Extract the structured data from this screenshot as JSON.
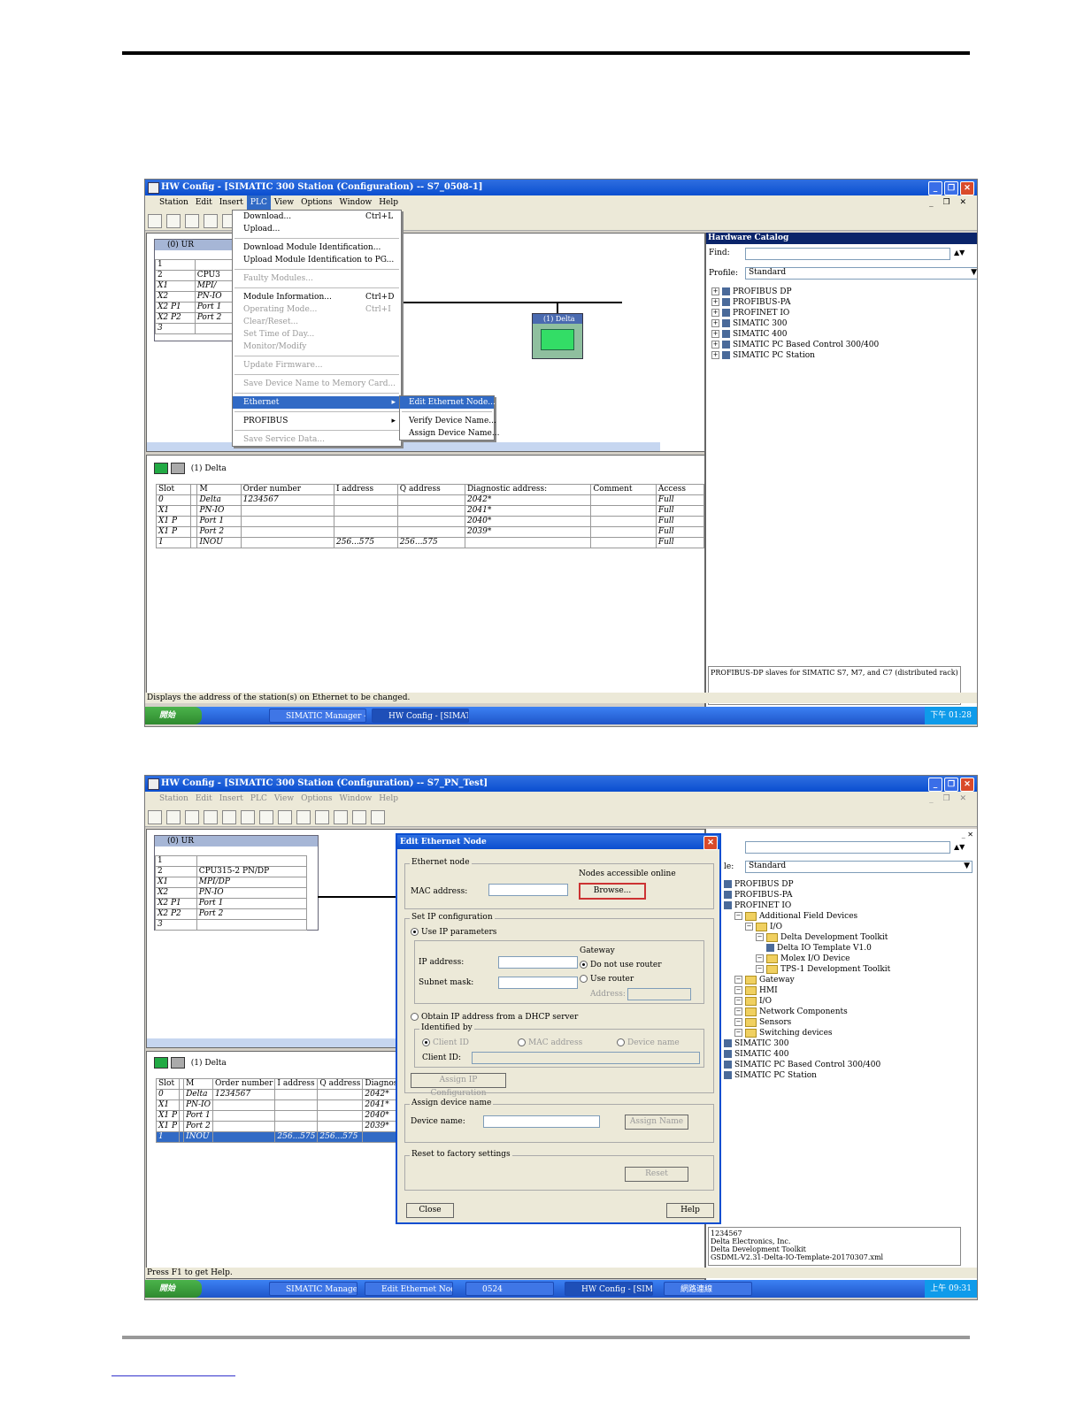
{
  "colors": {
    "titlebar": "#0a4ed0",
    "selection": "#316ac5",
    "start_button": "#2f8a2f"
  },
  "shot1": {
    "window_title": "HW Config - [SIMATIC 300 Station (Configuration) -- S7_0508-1]",
    "menu": [
      "Station",
      "Edit",
      "Insert",
      "PLC",
      "View",
      "Options",
      "Window",
      "Help"
    ],
    "rack_label": "(0) UR",
    "rack_rows": [
      {
        "slot": "1",
        "module": ""
      },
      {
        "slot": "2",
        "module": "CPU3"
      },
      {
        "slot": "X1",
        "module": "MPI/"
      },
      {
        "slot": "X2",
        "module": "PN-IO"
      },
      {
        "slot": "X2 P1",
        "module": "Port 1"
      },
      {
        "slot": "X2 P2",
        "module": "Port 2"
      },
      {
        "slot": "3",
        "module": ""
      }
    ],
    "device_label": "(1) Delta",
    "plc_menu": [
      {
        "label": "Download...",
        "shortcut": "Ctrl+L",
        "dis": false
      },
      {
        "label": "Upload...",
        "shortcut": "",
        "dis": false
      },
      {
        "sep": true
      },
      {
        "label": "Download Module Identification...",
        "shortcut": "",
        "dis": false
      },
      {
        "label": "Upload Module Identification to PG...",
        "shortcut": "",
        "dis": false
      },
      {
        "sep": true
      },
      {
        "label": "Faulty Modules...",
        "shortcut": "",
        "dis": true
      },
      {
        "sep": true
      },
      {
        "label": "Module Information...",
        "shortcut": "Ctrl+D",
        "dis": false
      },
      {
        "label": "Operating Mode...",
        "shortcut": "Ctrl+I",
        "dis": true
      },
      {
        "label": "Clear/Reset...",
        "shortcut": "",
        "dis": true
      },
      {
        "label": "Set Time of Day...",
        "shortcut": "",
        "dis": true
      },
      {
        "label": "Monitor/Modify",
        "shortcut": "",
        "dis": true
      },
      {
        "sep": true
      },
      {
        "label": "Update Firmware...",
        "shortcut": "",
        "dis": true
      },
      {
        "sep": true
      },
      {
        "label": "Save Device Name to Memory Card...",
        "shortcut": "",
        "dis": true
      },
      {
        "sep": true
      },
      {
        "label": "Ethernet",
        "shortcut": "",
        "dis": false,
        "hi": true,
        "sub": true
      },
      {
        "sep": true
      },
      {
        "label": "PROFIBUS",
        "shortcut": "",
        "dis": false,
        "sub": true
      },
      {
        "sep": true
      },
      {
        "label": "Save Service Data...",
        "shortcut": "",
        "dis": true
      }
    ],
    "ethernet_submenu": [
      "Edit Ethernet Node...",
      "Verify Device Name...",
      "Assign Device Name..."
    ],
    "catalog": {
      "title": "Hardware Catalog",
      "find_label": "Find:",
      "profile_label": "Profile:",
      "profile_value": "Standard",
      "tree": [
        "PROFIBUS DP",
        "PROFIBUS-PA",
        "PROFINET IO",
        "SIMATIC 300",
        "SIMATIC 400",
        "SIMATIC PC Based Control 300/400",
        "SIMATIC PC Station"
      ],
      "info": "PROFIBUS-DP slaves for SIMATIC S7, M7, and C7 (distributed rack)"
    },
    "detail_title": "(1)  Delta",
    "columns": [
      "Slot",
      "",
      "M",
      "Order number",
      "I address",
      "Q address",
      "Diagnostic address:",
      "Comment",
      "Access"
    ],
    "rows": [
      [
        "0",
        "",
        "Delta",
        "1234567",
        "",
        "",
        "2042*",
        "",
        "Full"
      ],
      [
        "X1",
        "",
        "PN-IO",
        "",
        "",
        "",
        "2041*",
        "",
        "Full"
      ],
      [
        "X1 P",
        "",
        "Port 1",
        "",
        "",
        "",
        "2040*",
        "",
        "Full"
      ],
      [
        "X1 P",
        "",
        "Port 2",
        "",
        "",
        "",
        "2039*",
        "",
        "Full"
      ],
      [
        "1",
        "",
        "INOU",
        "",
        "256...575",
        "256...575",
        "",
        "",
        "Full"
      ]
    ],
    "status": "Displays the address of the station(s) on Ethernet to be changed.",
    "start": "開始",
    "tasks": [
      "SIMATIC Manager - S...",
      "HW Config - [SIMAT..."
    ],
    "clock": "下午 01:28"
  },
  "shot2": {
    "window_title": "HW Config - [SIMATIC 300 Station (Configuration) -- S7_PN_Test]",
    "menu": [
      "Station",
      "Edit",
      "Insert",
      "PLC",
      "View",
      "Options",
      "Window",
      "Help"
    ],
    "rack_label": "(0) UR",
    "rack_rows": [
      {
        "slot": "1",
        "module": ""
      },
      {
        "slot": "2",
        "module": "CPU315-2 PN/DP"
      },
      {
        "slot": "X1",
        "module": "MPI/DP"
      },
      {
        "slot": "X2",
        "module": "PN-IO"
      },
      {
        "slot": "X2 P1",
        "module": "Port 1"
      },
      {
        "slot": "X2 P2",
        "module": "Port 2"
      },
      {
        "slot": "3",
        "module": ""
      }
    ],
    "dialog": {
      "title": "Edit Ethernet Node",
      "grp_ethernet": "Ethernet node",
      "nodes_online": "Nodes accessible online",
      "mac_label": "MAC address:",
      "browse": "Browse...",
      "grp_ip": "Set IP configuration",
      "use_ip": "Use IP parameters",
      "gateway": "Gateway",
      "ip_label": "IP address:",
      "subnet_label": "Subnet mask:",
      "no_router": "Do not use router",
      "use_router": "Use router",
      "address": "Address:",
      "dhcp": "Obtain IP address from a DHCP server",
      "identified_by": "Identified by",
      "client_id": "Client ID",
      "mac_opt": "MAC address",
      "device_name_opt": "Device name",
      "client_id_label": "Client ID:",
      "assign_ip": "Assign IP Configuration",
      "grp_name": "Assign device name",
      "device_name_label": "Device name:",
      "assign_name": "Assign Name",
      "grp_reset": "Reset to factory settings",
      "reset": "Reset",
      "close": "Close",
      "help": "Help"
    },
    "catalog": {
      "profile_label": "le:",
      "profile_value": "Standard",
      "tree": [
        {
          "label": "PROFIBUS DP",
          "indent": 0,
          "kind": "ico"
        },
        {
          "label": "PROFIBUS-PA",
          "indent": 0,
          "kind": "ico"
        },
        {
          "label": "PROFINET IO",
          "indent": 0,
          "kind": "ico"
        },
        {
          "label": "Additional Field Devices",
          "indent": 1,
          "kind": "folder"
        },
        {
          "label": "I/O",
          "indent": 2,
          "kind": "folder"
        },
        {
          "label": "Delta Development Toolkit",
          "indent": 3,
          "kind": "folder"
        },
        {
          "label": "Delta IO Template V1.0",
          "indent": 4,
          "kind": "ico"
        },
        {
          "label": "Molex I/O Device",
          "indent": 3,
          "kind": "folder"
        },
        {
          "label": "TPS-1 Development Toolkit",
          "indent": 3,
          "kind": "folder"
        },
        {
          "label": "Gateway",
          "indent": 1,
          "kind": "folder"
        },
        {
          "label": "HMI",
          "indent": 1,
          "kind": "folder"
        },
        {
          "label": "I/O",
          "indent": 1,
          "kind": "folder"
        },
        {
          "label": "Network Components",
          "indent": 1,
          "kind": "folder"
        },
        {
          "label": "Sensors",
          "indent": 1,
          "kind": "folder"
        },
        {
          "label": "Switching devices",
          "indent": 1,
          "kind": "folder"
        },
        {
          "label": "SIMATIC 300",
          "indent": 0,
          "kind": "ico"
        },
        {
          "label": "SIMATIC 400",
          "indent": 0,
          "kind": "ico"
        },
        {
          "label": "SIMATIC PC Based Control 300/400",
          "indent": 0,
          "kind": "ico"
        },
        {
          "label": "SIMATIC PC Station",
          "indent": 0,
          "kind": "ico"
        }
      ],
      "info": [
        "1234567",
        "Delta Electronics, Inc.",
        "Delta Development Toolkit",
        "GSDML-V2.31-Delta-IO-Template-20170307.xml"
      ]
    },
    "detail_title": "(1)  Delta",
    "columns": [
      "Slot",
      "",
      "M",
      "Order number",
      "I address",
      "Q address",
      "Diagnostic a"
    ],
    "rows": [
      [
        "0",
        "",
        "Delta",
        "1234567",
        "",
        "",
        "2042*"
      ],
      [
        "X1",
        "",
        "PN-IO",
        "",
        "",
        "",
        "2041*"
      ],
      [
        "X1 P",
        "",
        "Port 1",
        "",
        "",
        "",
        "2040*"
      ],
      [
        "X1 P",
        "",
        "Port 2",
        "",
        "",
        "",
        "2039*"
      ],
      [
        "1",
        "",
        "INOU",
        "",
        "256...575",
        "256...575",
        ""
      ]
    ],
    "status": "Press F1 to get Help.",
    "start": "開始",
    "tasks": [
      "SIMATIC Manager -...",
      "Edit Ethernet Node J...",
      "0524",
      "HW Config - [SIMA...",
      "網路連線"
    ],
    "clock": "上午 09:31"
  }
}
